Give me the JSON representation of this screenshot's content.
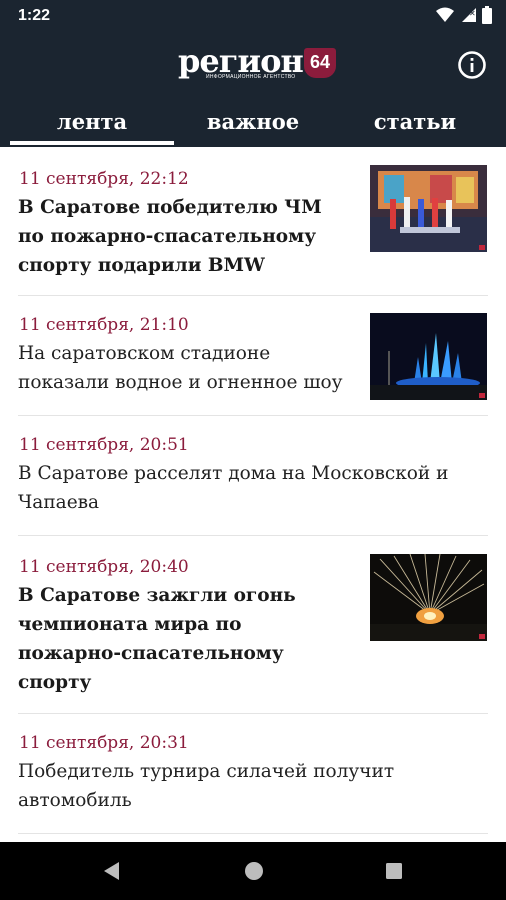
{
  "status_bar": {
    "time": "1:22",
    "icons": [
      "wifi-icon",
      "signal-icon",
      "battery-icon"
    ]
  },
  "header": {
    "logo_word": "регион",
    "logo_badge": "64",
    "logo_subtitle": "ИНФОРМАЦИОННОЕ АГЕНТСТВО",
    "info_icon": "info-icon"
  },
  "tabs": [
    {
      "label": "лента",
      "active": true
    },
    {
      "label": "важное",
      "active": false
    },
    {
      "label": "статьи",
      "active": false
    }
  ],
  "feed": [
    {
      "date": "11 сентября, 22:12",
      "lines": [
        "В Саратове победителю ЧМ",
        "по пожарно-спасательному",
        "спорту подарили BMW"
      ],
      "bold": true,
      "thumbnail": "award-ceremony-photo"
    },
    {
      "date": "11 сентября, 21:10",
      "lines": [
        "На саратовском стадионе",
        "показали водное и огненное шоу"
      ],
      "bold": false,
      "thumbnail": "fountain-show-photo"
    },
    {
      "date": "11 сентября, 20:51",
      "lines": [
        "В Саратове расселят дома на Московской и",
        "Чапаева"
      ],
      "bold": false,
      "thumbnail": null
    },
    {
      "date": "11 сентября, 20:40",
      "lines": [
        "В Саратове зажгли огонь",
        "чемпионата мира по",
        "пожарно-спасательному",
        "спорту"
      ],
      "bold": true,
      "thumbnail": "fireworks-photo"
    },
    {
      "date": "11 сентября, 20:31",
      "lines": [
        "Победитель турнира силачей получит",
        "автомобиль"
      ],
      "bold": false,
      "thumbnail": null
    }
  ],
  "colors": {
    "header_bg": "#1b2530",
    "accent": "#8b1c3c",
    "text": "#222222"
  },
  "nav_bar": {
    "icons": [
      "back-icon",
      "home-icon",
      "recents-icon"
    ]
  }
}
